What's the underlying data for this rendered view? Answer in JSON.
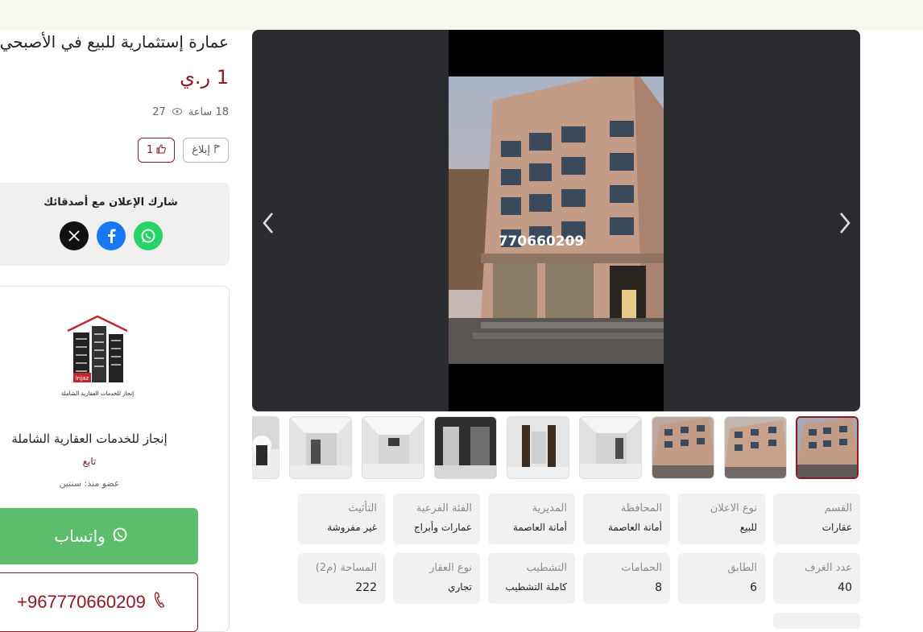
{
  "listing": {
    "title": "عمارة إستثمارية للبيع في الأصبحي",
    "price": "1 ر.ي",
    "time_ago": "18 ساعة",
    "views": "27",
    "report_label": "إبلاغ",
    "likes": "1"
  },
  "share": {
    "title": "شارك الإعلان مع أصدقائك",
    "icons": [
      "x-icon",
      "facebook-icon",
      "whatsapp-icon"
    ]
  },
  "seller": {
    "logo_text": "lnjaz",
    "logo_caption": "إنجاز للخدمات العقارية الشاملة",
    "name": "إنجاز للخدمات العقارية الشاملة",
    "follow_label": "تابع",
    "member_since": "عضو منذ: سنتين"
  },
  "contact": {
    "whatsapp_label": "واتساب",
    "phone": "+967770660209"
  },
  "gallery": {
    "photo_overlay_text": "770660209",
    "thumbnail_count": 9
  },
  "specs": [
    {
      "key": "القسم",
      "value": "عقارات"
    },
    {
      "key": "نوع الاعلان",
      "value": "للبيع"
    },
    {
      "key": "المحافظة",
      "value": "أمانة العاصمة"
    },
    {
      "key": "المديرية",
      "value": "أمانة العاصمة"
    },
    {
      "key": "الفئة الفرعية",
      "value": "عمارات وأبراج"
    },
    {
      "key": "التأثيث",
      "value": "غير مفروشة"
    },
    {
      "key": "عدد الغرف",
      "value": "40"
    },
    {
      "key": "الطابق",
      "value": "6"
    },
    {
      "key": "الحمامات",
      "value": "8"
    },
    {
      "key": "التشطيب",
      "value": "كاملة التشطيب"
    },
    {
      "key": "نوع العقار",
      "value": "تجاري"
    },
    {
      "key": "المساحة (م2)",
      "value": "222"
    }
  ],
  "colors": {
    "brand": "#8b1a24",
    "whatsapp": "#5cbd6c",
    "facebook": "#1877f2"
  }
}
